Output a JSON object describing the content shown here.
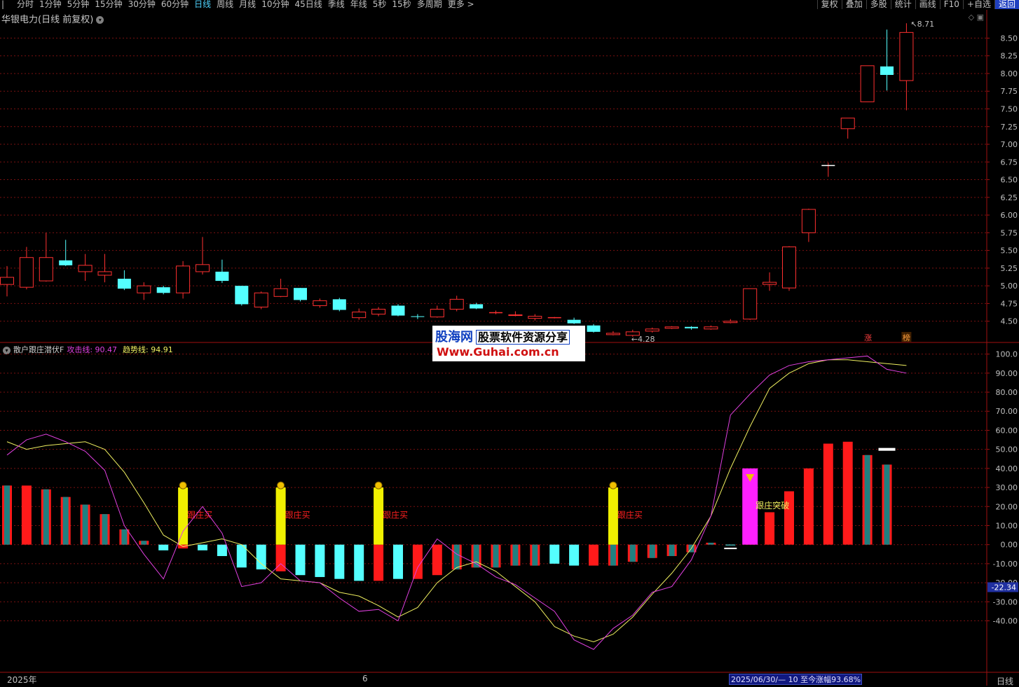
{
  "toolbar": {
    "lead_icon": "|",
    "periods": [
      "分时",
      "1分钟",
      "5分钟",
      "15分钟",
      "30分钟",
      "60分钟",
      "日线",
      "周线",
      "月线",
      "10分钟",
      "45日线",
      "季线",
      "年线",
      "5秒",
      "15秒",
      "多周期",
      "更多 >"
    ],
    "active_period": "日线",
    "tools": [
      "复权",
      "叠加",
      "多股",
      "统计",
      "画线",
      "F10",
      "+自选",
      "返回"
    ]
  },
  "stock": {
    "title": "华银电力(日线 前复权)",
    "high_label": "8.71",
    "low_label": "4.28",
    "marks": [
      "涨",
      "榜"
    ]
  },
  "indicator": {
    "name": "散户跟庄潜伏F",
    "attack_label": "攻击线: 90.47",
    "trend_label": "趋势线: 94.91",
    "follow_buy": "跟庄买",
    "breakout": "跟庄突破",
    "current_value": "-22.34"
  },
  "price_axis": [
    "8.50",
    "8.25",
    "8.00",
    "7.75",
    "7.50",
    "7.25",
    "7.00",
    "6.75",
    "6.50",
    "6.25",
    "6.00",
    "5.75",
    "5.50",
    "5.25",
    "5.00",
    "4.75",
    "4.50"
  ],
  "indicator_axis": [
    "100.0",
    "90.00",
    "80.00",
    "70.00",
    "60.00",
    "50.00",
    "40.00",
    "30.00",
    "20.00",
    "10.00",
    "0.00",
    "-10.00",
    "-20.00",
    "-30.00",
    "-40.00"
  ],
  "bottom": {
    "year_label": "2025年",
    "month_label": "6",
    "range_info": "2025/06/30/— 10 至今涨幅93.68%",
    "period_label": "日线"
  },
  "watermark": {
    "line1_a": "股海网",
    "line1_b": "股票软件资源分享",
    "line2": "Www.Guhai.com.cn"
  },
  "colors": {
    "up": "#ff3030",
    "down": "#54ffff",
    "attack": "#e040e0",
    "trend": "#f0f060",
    "grid": "#7a1010"
  },
  "chart_data": {
    "type": "candlestick",
    "candles": [
      [
        5.02,
        5.12,
        5.28,
        4.85
      ],
      [
        4.98,
        5.4,
        5.55,
        4.95
      ],
      [
        5.07,
        5.4,
        5.75,
        5.06
      ],
      [
        5.36,
        5.29,
        5.65,
        5.28
      ],
      [
        5.2,
        5.29,
        5.45,
        5.07
      ],
      [
        5.15,
        5.2,
        5.45,
        5.05
      ],
      [
        5.1,
        4.96,
        5.22,
        4.94
      ],
      [
        4.9,
        5.0,
        5.05,
        4.8
      ],
      [
        4.98,
        4.9,
        5.0,
        4.88
      ],
      [
        4.9,
        5.28,
        5.35,
        4.82
      ],
      [
        5.2,
        5.3,
        5.69,
        5.16
      ],
      [
        5.2,
        5.07,
        5.37,
        5.04
      ],
      [
        5.0,
        4.74,
        5.0,
        4.72
      ],
      [
        4.7,
        4.9,
        4.92,
        4.67
      ],
      [
        4.85,
        4.96,
        5.1,
        4.84
      ],
      [
        4.97,
        4.8,
        4.97,
        4.78
      ],
      [
        4.72,
        4.79,
        4.82,
        4.69
      ],
      [
        4.81,
        4.66,
        4.83,
        4.64
      ],
      [
        4.55,
        4.63,
        4.68,
        4.52
      ],
      [
        4.6,
        4.67,
        4.7,
        4.57
      ],
      [
        4.72,
        4.58,
        4.74,
        4.57
      ],
      [
        4.57,
        4.56,
        4.6,
        4.53
      ],
      [
        4.56,
        4.67,
        4.72,
        4.55
      ],
      [
        4.67,
        4.81,
        4.86,
        4.64
      ],
      [
        4.74,
        4.68,
        4.76,
        4.67
      ],
      [
        4.62,
        4.62,
        4.65,
        4.6
      ],
      [
        4.58,
        4.59,
        4.64,
        4.57
      ],
      [
        4.54,
        4.57,
        4.6,
        4.51
      ],
      [
        4.55,
        4.55,
        4.56,
        4.54
      ],
      [
        4.52,
        4.47,
        4.55,
        4.46
      ],
      [
        4.44,
        4.35,
        4.46,
        4.34
      ],
      [
        4.31,
        4.33,
        4.36,
        4.3
      ],
      [
        4.3,
        4.35,
        4.38,
        4.28
      ],
      [
        4.36,
        4.39,
        4.41,
        4.34
      ],
      [
        4.4,
        4.42,
        4.43,
        4.39
      ],
      [
        4.42,
        4.4,
        4.43,
        4.38
      ],
      [
        4.39,
        4.42,
        4.44,
        4.38
      ],
      [
        4.48,
        4.5,
        4.53,
        4.47
      ],
      [
        4.53,
        4.96,
        4.96,
        4.52
      ],
      [
        5.02,
        5.05,
        5.19,
        4.93
      ],
      [
        4.97,
        5.55,
        5.56,
        4.93
      ],
      [
        5.75,
        6.08,
        6.09,
        5.62
      ],
      [
        6.7,
        6.7,
        6.74,
        6.54
      ],
      [
        7.22,
        7.37,
        7.37,
        7.08
      ],
      [
        7.6,
        8.11,
        8.11,
        7.6
      ],
      [
        8.1,
        7.98,
        8.62,
        7.76
      ],
      [
        7.9,
        8.58,
        8.71,
        7.48
      ]
    ],
    "attack_line": [
      47,
      55,
      58,
      54,
      49,
      39,
      10,
      -5,
      -18,
      7,
      20,
      6,
      -22,
      -20,
      -10,
      -19,
      -20,
      -28,
      -35,
      -34,
      -40,
      -12,
      3,
      -5,
      -10,
      -17,
      -21,
      -28,
      -35,
      -50,
      -55,
      -44,
      -37,
      -25,
      -22,
      -8,
      15,
      68,
      79,
      89,
      94,
      96,
      97,
      98,
      99,
      92,
      90
    ],
    "trend_line": [
      54,
      50,
      52,
      53,
      54,
      50,
      38,
      22,
      5,
      -1,
      1,
      3,
      0,
      -10,
      -18,
      -19,
      -20,
      -25,
      -27,
      -32,
      -38,
      -33,
      -20,
      -12,
      -9,
      -14,
      -22,
      -30,
      -43,
      -48,
      -51,
      -47,
      -38,
      -26,
      -15,
      -2,
      15,
      40,
      62,
      82,
      90,
      95,
      97,
      97,
      96,
      95,
      94
    ],
    "bars": [
      {
        "v": 31,
        "c": "m"
      },
      {
        "v": 31,
        "c": "r"
      },
      {
        "v": 29,
        "c": "m"
      },
      {
        "v": 25,
        "c": "m"
      },
      {
        "v": 21,
        "c": "m"
      },
      {
        "v": 16,
        "c": "m"
      },
      {
        "v": 8,
        "c": "m"
      },
      {
        "v": 2,
        "c": "m"
      },
      {
        "v": -3,
        "c": "c"
      },
      {
        "v": -2,
        "c": "r"
      },
      {
        "v": -3,
        "c": "c"
      },
      {
        "v": -6,
        "c": "c"
      },
      {
        "v": -12,
        "c": "c"
      },
      {
        "v": -13,
        "c": "c"
      },
      {
        "v": -14,
        "c": "r"
      },
      {
        "v": -16,
        "c": "c"
      },
      {
        "v": -17,
        "c": "c"
      },
      {
        "v": -18,
        "c": "c"
      },
      {
        "v": -19,
        "c": "c"
      },
      {
        "v": -19,
        "c": "r"
      },
      {
        "v": -18,
        "c": "c"
      },
      {
        "v": -18,
        "c": "r"
      },
      {
        "v": -16,
        "c": "r"
      },
      {
        "v": -13,
        "c": "m"
      },
      {
        "v": -12,
        "c": "m"
      },
      {
        "v": -12,
        "c": "m"
      },
      {
        "v": -11,
        "c": "m"
      },
      {
        "v": -11,
        "c": "m"
      },
      {
        "v": -10,
        "c": "c"
      },
      {
        "v": -11,
        "c": "c"
      },
      {
        "v": -11,
        "c": "r"
      },
      {
        "v": -11,
        "c": "m"
      },
      {
        "v": -9,
        "c": "m"
      },
      {
        "v": -7,
        "c": "m"
      },
      {
        "v": -6,
        "c": "m"
      },
      {
        "v": -4,
        "c": "m"
      },
      {
        "v": 1,
        "c": "m"
      },
      {
        "v": 0,
        "c": "c"
      },
      {
        "v": 9,
        "c": "r"
      },
      {
        "v": 17,
        "c": "r"
      },
      {
        "v": 28,
        "c": "r"
      },
      {
        "v": 40,
        "c": "r"
      },
      {
        "v": 53,
        "c": "r"
      },
      {
        "v": 54,
        "c": "r"
      },
      {
        "v": 47,
        "c": "m"
      },
      {
        "v": 42,
        "c": "m"
      }
    ],
    "signals": [
      9,
      14,
      19,
      31
    ],
    "breakout_index": 38,
    "price_range": [
      4.2,
      8.9
    ],
    "indicator_range": [
      -67,
      105
    ]
  }
}
